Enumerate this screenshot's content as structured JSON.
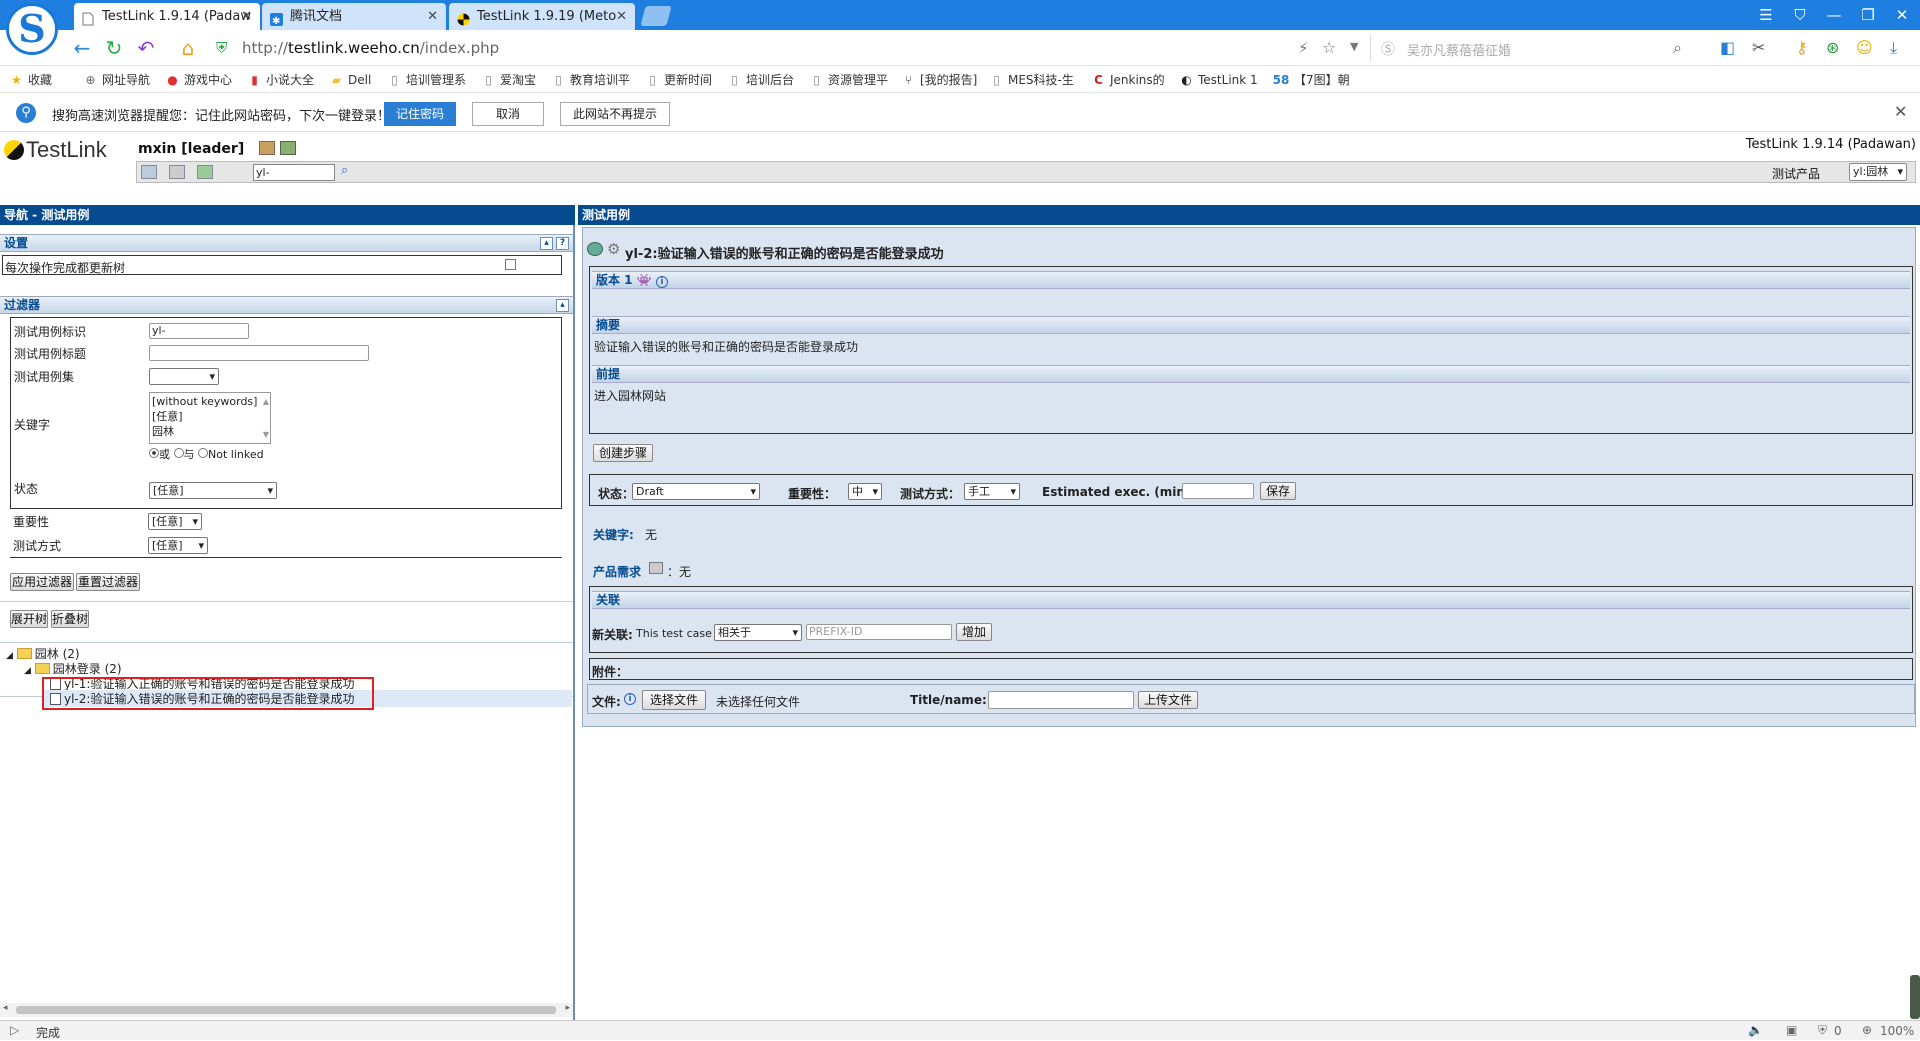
{
  "browser": {
    "tabs": [
      {
        "label": "TestLink 1.9.14 (Padaw"
      },
      {
        "label": "腾讯文档"
      },
      {
        "label": "TestLink 1.9.19 (Meto"
      }
    ],
    "url_prefix": "http://",
    "url_domain": "testlink.weeho.cn",
    "url_path": "/index.php",
    "search_placeholder": "吴亦凡蔡蓓蓓征婚",
    "bookmarks": [
      {
        "label": "收藏",
        "icon": "star-icon"
      },
      {
        "label": "网址导航",
        "icon": "globe-icon"
      },
      {
        "label": "游戏中心",
        "icon": "game-icon"
      },
      {
        "label": "小说大全",
        "icon": "book-icon"
      },
      {
        "label": "Dell",
        "icon": "folder-icon"
      },
      {
        "label": "培训管理系",
        "icon": "page-icon"
      },
      {
        "label": "爱淘宝",
        "icon": "page-icon"
      },
      {
        "label": "教育培训平",
        "icon": "page-icon"
      },
      {
        "label": "更新时间",
        "icon": "page-icon"
      },
      {
        "label": "培训后台",
        "icon": "page-icon"
      },
      {
        "label": "资源管理平",
        "icon": "page-icon"
      },
      {
        "label": "[我的报告]",
        "icon": "fork-icon"
      },
      {
        "label": "MES科技-生",
        "icon": "page-icon"
      },
      {
        "label": "Jenkins的",
        "icon": "c-icon"
      },
      {
        "label": "TestLink 1",
        "icon": "testlink-icon"
      },
      {
        "label": "【7图】朝",
        "icon": "58-icon"
      }
    ],
    "pwbar": {
      "message": "搜狗高速浏览器提醒您：记住此网站密码，下次一键登录！",
      "remember": "记住密码",
      "cancel": "取消",
      "never": "此网站不再提示"
    },
    "status_text": "完成",
    "status_count": "0",
    "zoom": "100%"
  },
  "header": {
    "logo_text": "TestLink",
    "user": "mxin [leader]",
    "version": "TestLink 1.9.14 (Padawan)",
    "tc_id_value": "yl-",
    "product_label": "测试产品",
    "product_value": "yl:园林"
  },
  "left": {
    "title": "导航 - 测试用例",
    "settings": {
      "title": "设置",
      "refresh_label": "每次操作完成都更新树"
    },
    "filters": {
      "title": "过滤器",
      "tc_id_label": "测试用例标识",
      "tc_id_value": "yl-",
      "tc_title_label": "测试用例标题",
      "tc_title_value": "",
      "suite_label": "测试用例集",
      "suite_value": "",
      "keyword_label": "关键字",
      "keywords": [
        "[without keywords]",
        "[任意]",
        "园林"
      ],
      "radio_or": "或",
      "radio_and": "与",
      "radio_not": "Not linked",
      "status_label": "状态",
      "status_value": "[任意]",
      "importance_label": "重要性",
      "importance_value": "[任意]",
      "exec_label": "测试方式",
      "exec_value": "[任意]",
      "apply": "应用过滤器",
      "reset": "重置过滤器"
    },
    "expand": "展开树",
    "collapse": "折叠树",
    "tree": {
      "root": "园林 (2)",
      "suite": "园林登录 (2)",
      "cases": [
        "yl-1:验证输入正确的账号和错误的密码是否能登录成功",
        "yl-2:验证输入错误的账号和正确的密码是否能登录成功"
      ]
    }
  },
  "right": {
    "title": "测试用例",
    "case_title": "yl-2:验证输入错误的账号和正确的密码是否能登录成功",
    "version_label": "版本 1",
    "summary_label": "摘要",
    "summary": "验证输入错误的账号和正确的密码是否能登录成功",
    "precondition_label": "前提",
    "precondition": "进入园林网站",
    "create_steps": "创建步骤",
    "status_label": "状态：",
    "status_value": "Draft",
    "importance_label": "重要性：",
    "importance_value": "中",
    "exec_label": "测试方式：",
    "exec_value": "手工",
    "est_label": "Estimated exec. (min) :",
    "save": "保存",
    "keywords_label": "关键字:",
    "keywords_value": "无",
    "req_label": "产品需求",
    "req_value": "：无",
    "relations_label": "关联",
    "new_relation_label": "新关联:",
    "this_case": "This test case",
    "relation_type": "相关于",
    "relation_placeholder": "PREFIX-ID",
    "add": "增加",
    "attachments_label": "附件：",
    "file_label": "文件:",
    "choose_file": "选择文件",
    "no_file": "未选择任何文件",
    "title_name_label": "Title/name:",
    "upload": "上传文件"
  }
}
